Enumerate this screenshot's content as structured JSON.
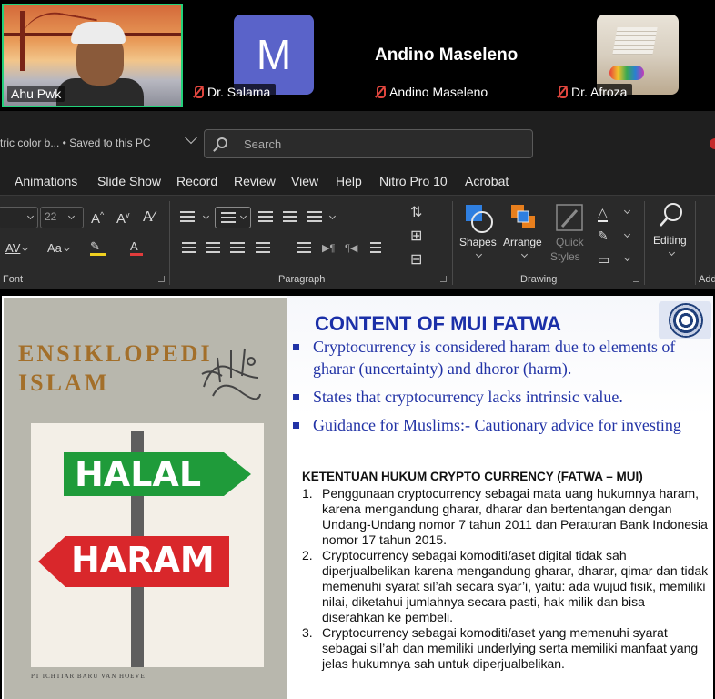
{
  "video": {
    "self_name": "Ahu Pwk",
    "participants": [
      {
        "name": "Dr. Salama",
        "avatar_letter": "M"
      },
      {
        "name": "Andino Maseleno",
        "display_name": "Andino Maseleno"
      },
      {
        "name": "Dr. Afroza"
      }
    ]
  },
  "titlebar": {
    "doc_title": "tric color b...  •  Saved to this PC",
    "search_placeholder": "Search"
  },
  "tabs": [
    "Animations",
    "Slide Show",
    "Record",
    "Review",
    "View",
    "Help",
    "Nitro Pro 10",
    "Acrobat"
  ],
  "ribbon": {
    "font_size": "22",
    "groups": {
      "font": "Font",
      "paragraph": "Paragraph",
      "drawing": "Drawing",
      "add": "Add"
    },
    "buttons": {
      "shapes": "Shapes",
      "arrange": "Arrange",
      "quick_styles_1": "Quick",
      "quick_styles_2": "Styles",
      "editing": "Editing"
    }
  },
  "slide": {
    "cover": {
      "title_line1": "ENSIKLOPEDI",
      "title_line2": "ISLAM",
      "halal": "HALAL",
      "haram": "HARAM",
      "publisher": "PT ICHTIAR BARU VAN HOEVE"
    },
    "heading": "CONTENT OF MUI FATWA",
    "bullets": [
      "Cryptocurrency is considered haram due to elements of gharar (uncertainty) and dhoror (harm).",
      "States that cryptocurrency lacks intrinsic value.",
      "Guidance for Muslims:- Cautionary advice for investing"
    ],
    "rules_heading": "KETENTUAN HUKUM CRYPTO CURRENCY (FATWA – MUI)",
    "rules": [
      {
        "num": "1.",
        "text": "Penggunaan cryptocurrency sebagai mata uang hukumnya haram, karena mengandung gharar, dharar dan bertentangan dengan Undang-Undang nomor 7 tahun 2011 dan Peraturan Bank Indonesia nomor 17 tahun 2015."
      },
      {
        "num": "2.",
        "text": "Cryptocurrency sebagai komoditi/aset digital tidak sah diperjualbelikan karena mengandung gharar, dharar, qimar dan tidak memenuhi syarat sil’ah secara syar’i, yaitu: ada wujud fisik, memiliki nilai, diketahui jumlahnya secara pasti, hak milik dan bisa diserahkan ke pembeli."
      },
      {
        "num": "3.",
        "text": "Cryptocurrency sebagai komoditi/aset yang memenuhi syarat sebagai sil’ah dan memiliki underlying serta memiliki manfaat yang jelas hukumnya sah untuk diperjualbelikan."
      }
    ]
  }
}
